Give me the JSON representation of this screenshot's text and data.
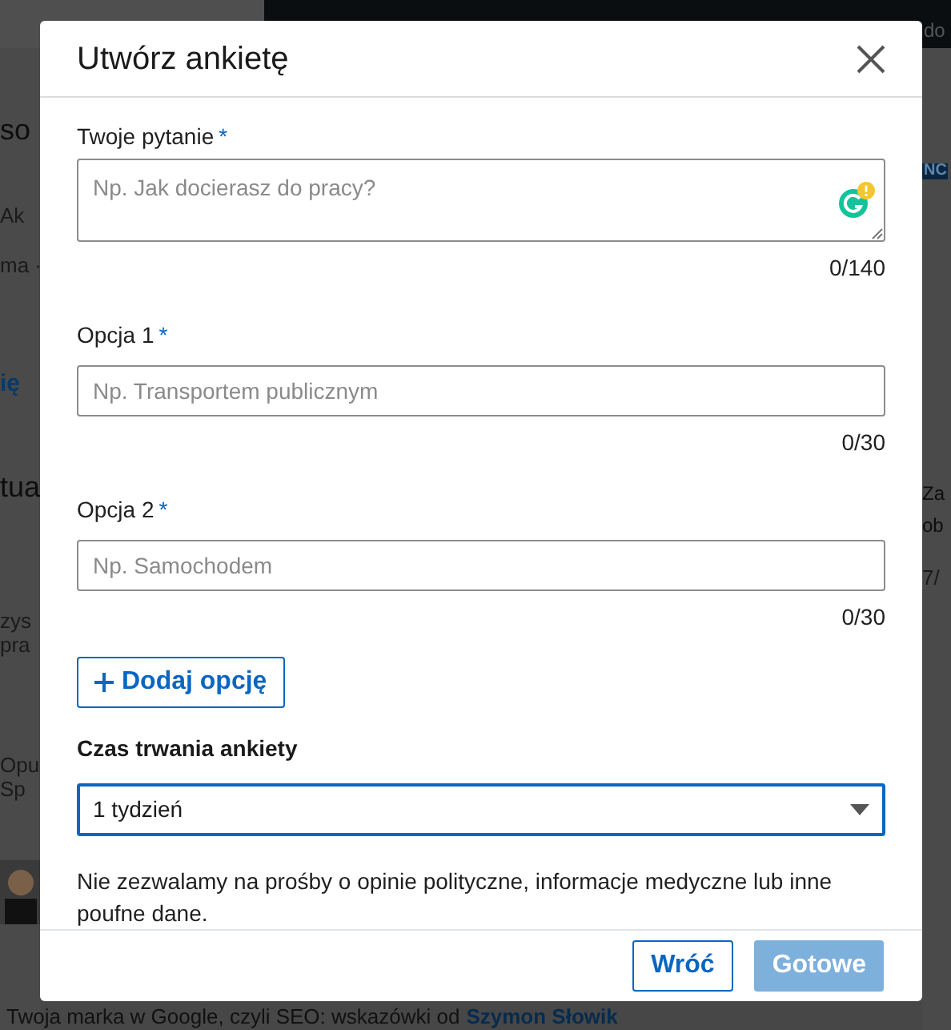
{
  "background": {
    "nav_label": "do",
    "left_fragments": [
      {
        "text": "so",
        "kind": "heading"
      },
      {
        "text": "Ak",
        "kind": "text"
      },
      {
        "text": "ma ·",
        "kind": "text"
      },
      {
        "text": "ię",
        "kind": "link"
      },
      {
        "text": "tua",
        "kind": "heading"
      },
      {
        "text": "zys",
        "kind": "text"
      },
      {
        "text": "pra",
        "kind": "text"
      },
      {
        "text": "Opu",
        "kind": "text"
      },
      {
        "text": "Sp",
        "kind": "text"
      }
    ],
    "right_fragments": [
      {
        "text": "NC",
        "kind": "badge"
      },
      {
        "text": "Za",
        "kind": "heading"
      },
      {
        "text": "ob",
        "kind": "heading"
      },
      {
        "text": "7/",
        "kind": "text"
      }
    ],
    "post_line": "Twoja marka w Google, czyli SEO: wskazówki od",
    "post_link": "Szymon Słowik"
  },
  "dialog": {
    "title": "Utwórz ankietę",
    "question": {
      "label": "Twoje pytanie",
      "required_mark": "*",
      "placeholder": "Np. Jak docierasz do pracy?",
      "counter": "0/140"
    },
    "options": [
      {
        "label": "Opcja 1",
        "required_mark": "*",
        "placeholder": "Np. Transportem publicznym",
        "counter": "0/30"
      },
      {
        "label": "Opcja 2",
        "required_mark": "*",
        "placeholder": "Np. Samochodem",
        "counter": "0/30"
      }
    ],
    "add_option": "Dodaj opcję",
    "duration": {
      "label": "Czas trwania ankiety",
      "value": "1 tydzień",
      "focused": true
    },
    "notice": "Nie zezwalamy na prośby o opinie polityczne, informacje medyczne lub inne poufne dane.",
    "buttons": [
      {
        "label": "Wróć",
        "kind": "secondary",
        "disabled": false
      },
      {
        "label": "Gotowe",
        "kind": "primary",
        "disabled": true
      }
    ]
  }
}
